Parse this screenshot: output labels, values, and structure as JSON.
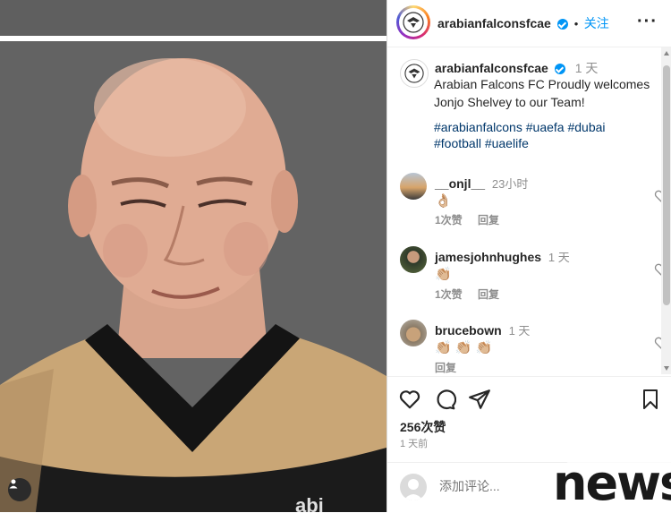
{
  "header": {
    "username": "arabianfalconsfcae",
    "separator": "•",
    "follow_label": "关注",
    "more_label": "···"
  },
  "caption": {
    "username": "arabianfalconsfcae",
    "time": "1 天",
    "text": "Arabian Falcons FC Proudly welcomes Jonjo Shelvey to our Team!",
    "hashtags": [
      "#arabianfalcons",
      "#uaefa",
      "#dubai",
      "#football",
      "#uaelife"
    ]
  },
  "comments": [
    {
      "username": "__onjl__",
      "time": "23小时",
      "text": "👌🏼",
      "likes": "1次赞",
      "reply": "回复"
    },
    {
      "username": "jamesjohnhughes",
      "time": "1 天",
      "text": "👏🏼",
      "likes": "1次赞",
      "reply": "回复"
    },
    {
      "username": "brucebown",
      "time": "1 天",
      "text": "👏🏼 👏🏼 👏🏼",
      "likes": "",
      "reply": "回复"
    }
  ],
  "post": {
    "likes": "256次赞",
    "time_ago": "1 天前"
  },
  "add_comment": {
    "placeholder": "添加评论..."
  },
  "watermark": {
    "text": "news"
  },
  "colors": {
    "accent": "#0095f6",
    "hashtag": "#00376b",
    "kit_gold": "#c8a574",
    "kit_black": "#1b1b1b"
  },
  "icons": [
    "user-tag-icon",
    "verified-icon",
    "more-icon",
    "heart-icon",
    "comment-icon",
    "share-icon",
    "bookmark-icon",
    "avatar-icon"
  ]
}
